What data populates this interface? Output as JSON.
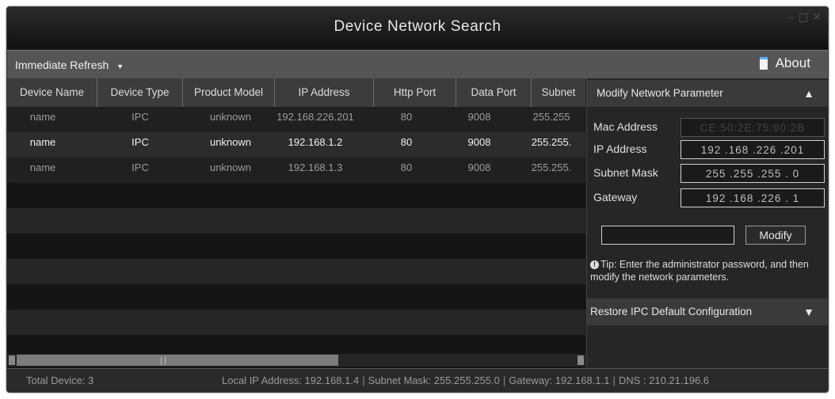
{
  "window": {
    "title": "Device Network Search"
  },
  "toolbar": {
    "refresh_label": "Immediate Refresh",
    "refresh_caret": "▼",
    "about_label": "About",
    "about_icon": "info-icon"
  },
  "table": {
    "columns": [
      "Device Name",
      "Device Type",
      "Product Model",
      "IP Address",
      "Http Port",
      "Data Port",
      "Subnet"
    ],
    "rows": [
      {
        "name": "name",
        "type": "IPC",
        "model": "unknown",
        "ip": "192.168.226.201",
        "http": "80",
        "data": "9008",
        "subnet": "255.255"
      },
      {
        "name": "name",
        "type": "IPC",
        "model": "unknown",
        "ip": "192.168.1.2",
        "http": "80",
        "data": "9008",
        "subnet": "255.255."
      },
      {
        "name": "name",
        "type": "IPC",
        "model": "unknown",
        "ip": "192.168.1.3",
        "http": "80",
        "data": "9008",
        "subnet": "255.255."
      }
    ]
  },
  "panel": {
    "modify_header": "Modify Network Parameter",
    "collapse_arrow": "▲",
    "mac_label": "Mac Address",
    "mac_value": "CE:50:2E:75:90:2B",
    "ip_label": "IP Address",
    "ip_value": "192 .168 .226 .201",
    "mask_label": "Subnet Mask",
    "mask_value": "255 .255 .255 . 0",
    "gateway_label": "Gateway",
    "gateway_value": "192 .168 .226 . 1",
    "modify_button": "Modify",
    "tip_icon": "!",
    "tip_text": "Tip: Enter the administrator password, and then modify the network parameters.",
    "restore_header": "Restore IPC Default Configuration",
    "expand_arrow": "▼"
  },
  "status": {
    "total": "Total Device: 3",
    "local_ip": "Local IP Address: 192.168.1.4",
    "subnet": "Subnet Mask: 255.255.255.0",
    "gateway": "Gateway: 192.168.1.1",
    "dns": "DNS : 210.21.196.6",
    "separator": "|"
  },
  "colors": {
    "background": "#1e1e1e",
    "toolbar": "#555555",
    "accent": "#5ab0ff"
  }
}
